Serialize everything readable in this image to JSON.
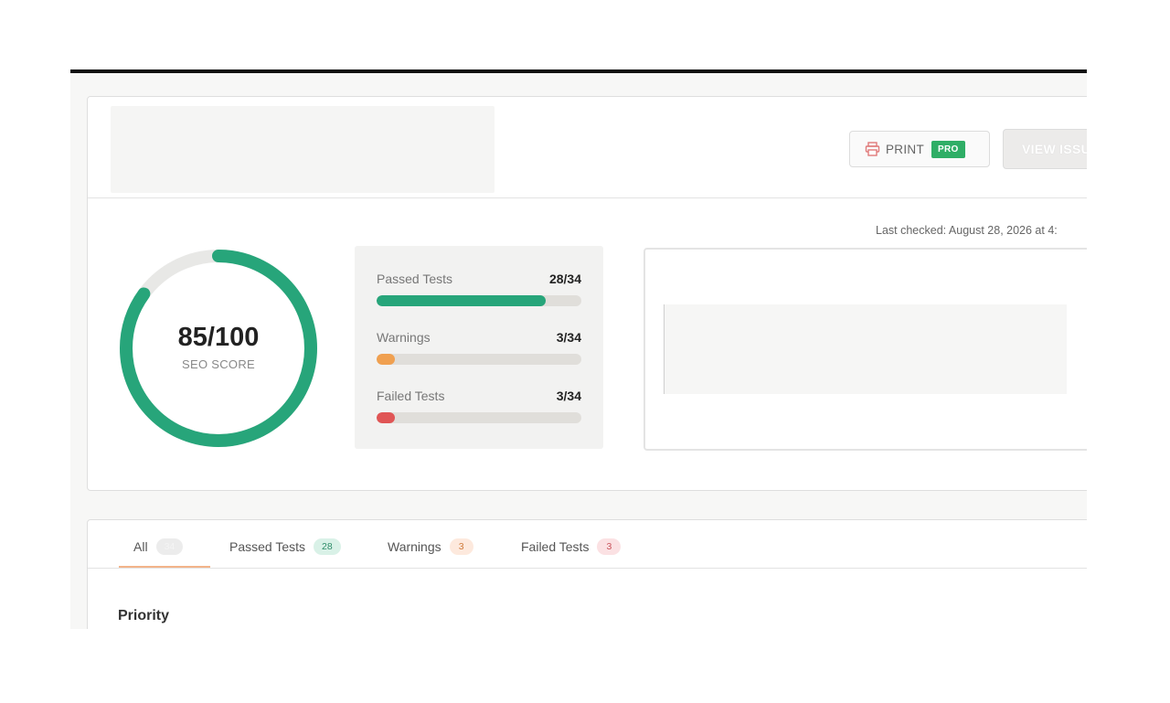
{
  "header": {
    "print_label": "PRINT",
    "pro_label": "PRO",
    "view_issues_label": "VIEW ISSU"
  },
  "last_checked": "Last checked: August 28, 2026 at 4:",
  "score": {
    "value": "85/100",
    "label": "SEO SCORE",
    "fraction": 0.85
  },
  "stats": [
    {
      "name": "Passed Tests",
      "count": "28/34",
      "fraction": 0.824,
      "color": "#27a57a"
    },
    {
      "name": "Warnings",
      "count": "3/34",
      "fraction": 0.088,
      "color": "#f0a050"
    },
    {
      "name": "Failed Tests",
      "count": "3/34",
      "fraction": 0.088,
      "color": "#e05555"
    }
  ],
  "tabs": [
    {
      "label": "All",
      "badge": "34",
      "badge_bg": "#ececec",
      "badge_color": "#f4f4f4"
    },
    {
      "label": "Passed Tests",
      "badge": "28",
      "badge_bg": "#d9f1e7",
      "badge_color": "#2f8d69"
    },
    {
      "label": "Warnings",
      "badge": "3",
      "badge_bg": "#fde9dd",
      "badge_color": "#d07b3c"
    },
    {
      "label": "Failed Tests",
      "badge": "3",
      "badge_bg": "#fbe1e3",
      "badge_color": "#c9545c"
    }
  ],
  "section_title": "Priority",
  "colors": {
    "accent": "#27a57a",
    "track": "#e8e8e6"
  }
}
